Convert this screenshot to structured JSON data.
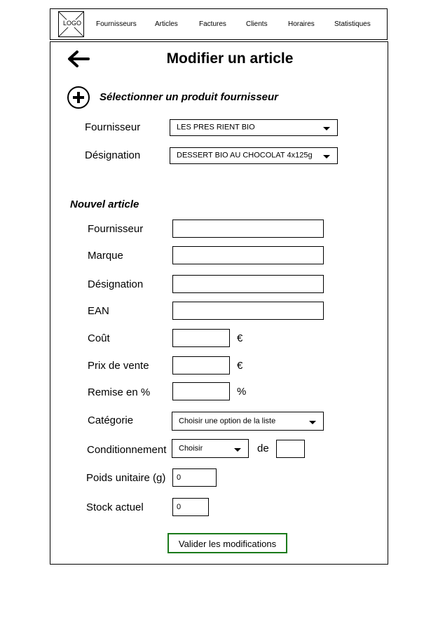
{
  "nav": {
    "logo": "LOGO",
    "items": [
      "Fournisseurs",
      "Articles",
      "Factures",
      "Clients",
      "Horaires",
      "Statistiques"
    ]
  },
  "page": {
    "title": "Modifier un article"
  },
  "select_product": {
    "heading": "Sélectionner un produit fournisseur",
    "supplier_label": "Fournisseur",
    "supplier_value": "LES PRES RIENT BIO",
    "designation_label": "Désignation",
    "designation_value": "DESSERT BIO AU CHOCOLAT 4x125g"
  },
  "new_article": {
    "heading": "Nouvel article",
    "supplier_label": "Fournisseur",
    "supplier_value": "",
    "brand_label": "Marque",
    "brand_value": "",
    "designation_label": "Désignation",
    "designation_value": "",
    "ean_label": "EAN",
    "ean_value": "",
    "cost_label": "Coût",
    "cost_value": "",
    "cost_unit": "€",
    "price_label": "Prix de vente",
    "price_value": "",
    "price_unit": "€",
    "discount_label": "Remise en %",
    "discount_value": "",
    "discount_unit": "%",
    "category_label": "Catégorie",
    "category_value": "Choisir une option de la liste",
    "packaging_label": "Conditionnement",
    "packaging_value": "Choisir",
    "packaging_of": "de",
    "packaging_qty": "",
    "weight_label": "Poids unitaire (g)",
    "weight_value": "0",
    "stock_label": "Stock actuel",
    "stock_value": "0",
    "submit_label": "Valider les modifications"
  },
  "colors": {
    "border": "#000000",
    "submit_border": "#1b7a1b",
    "background": "#ffffff"
  }
}
